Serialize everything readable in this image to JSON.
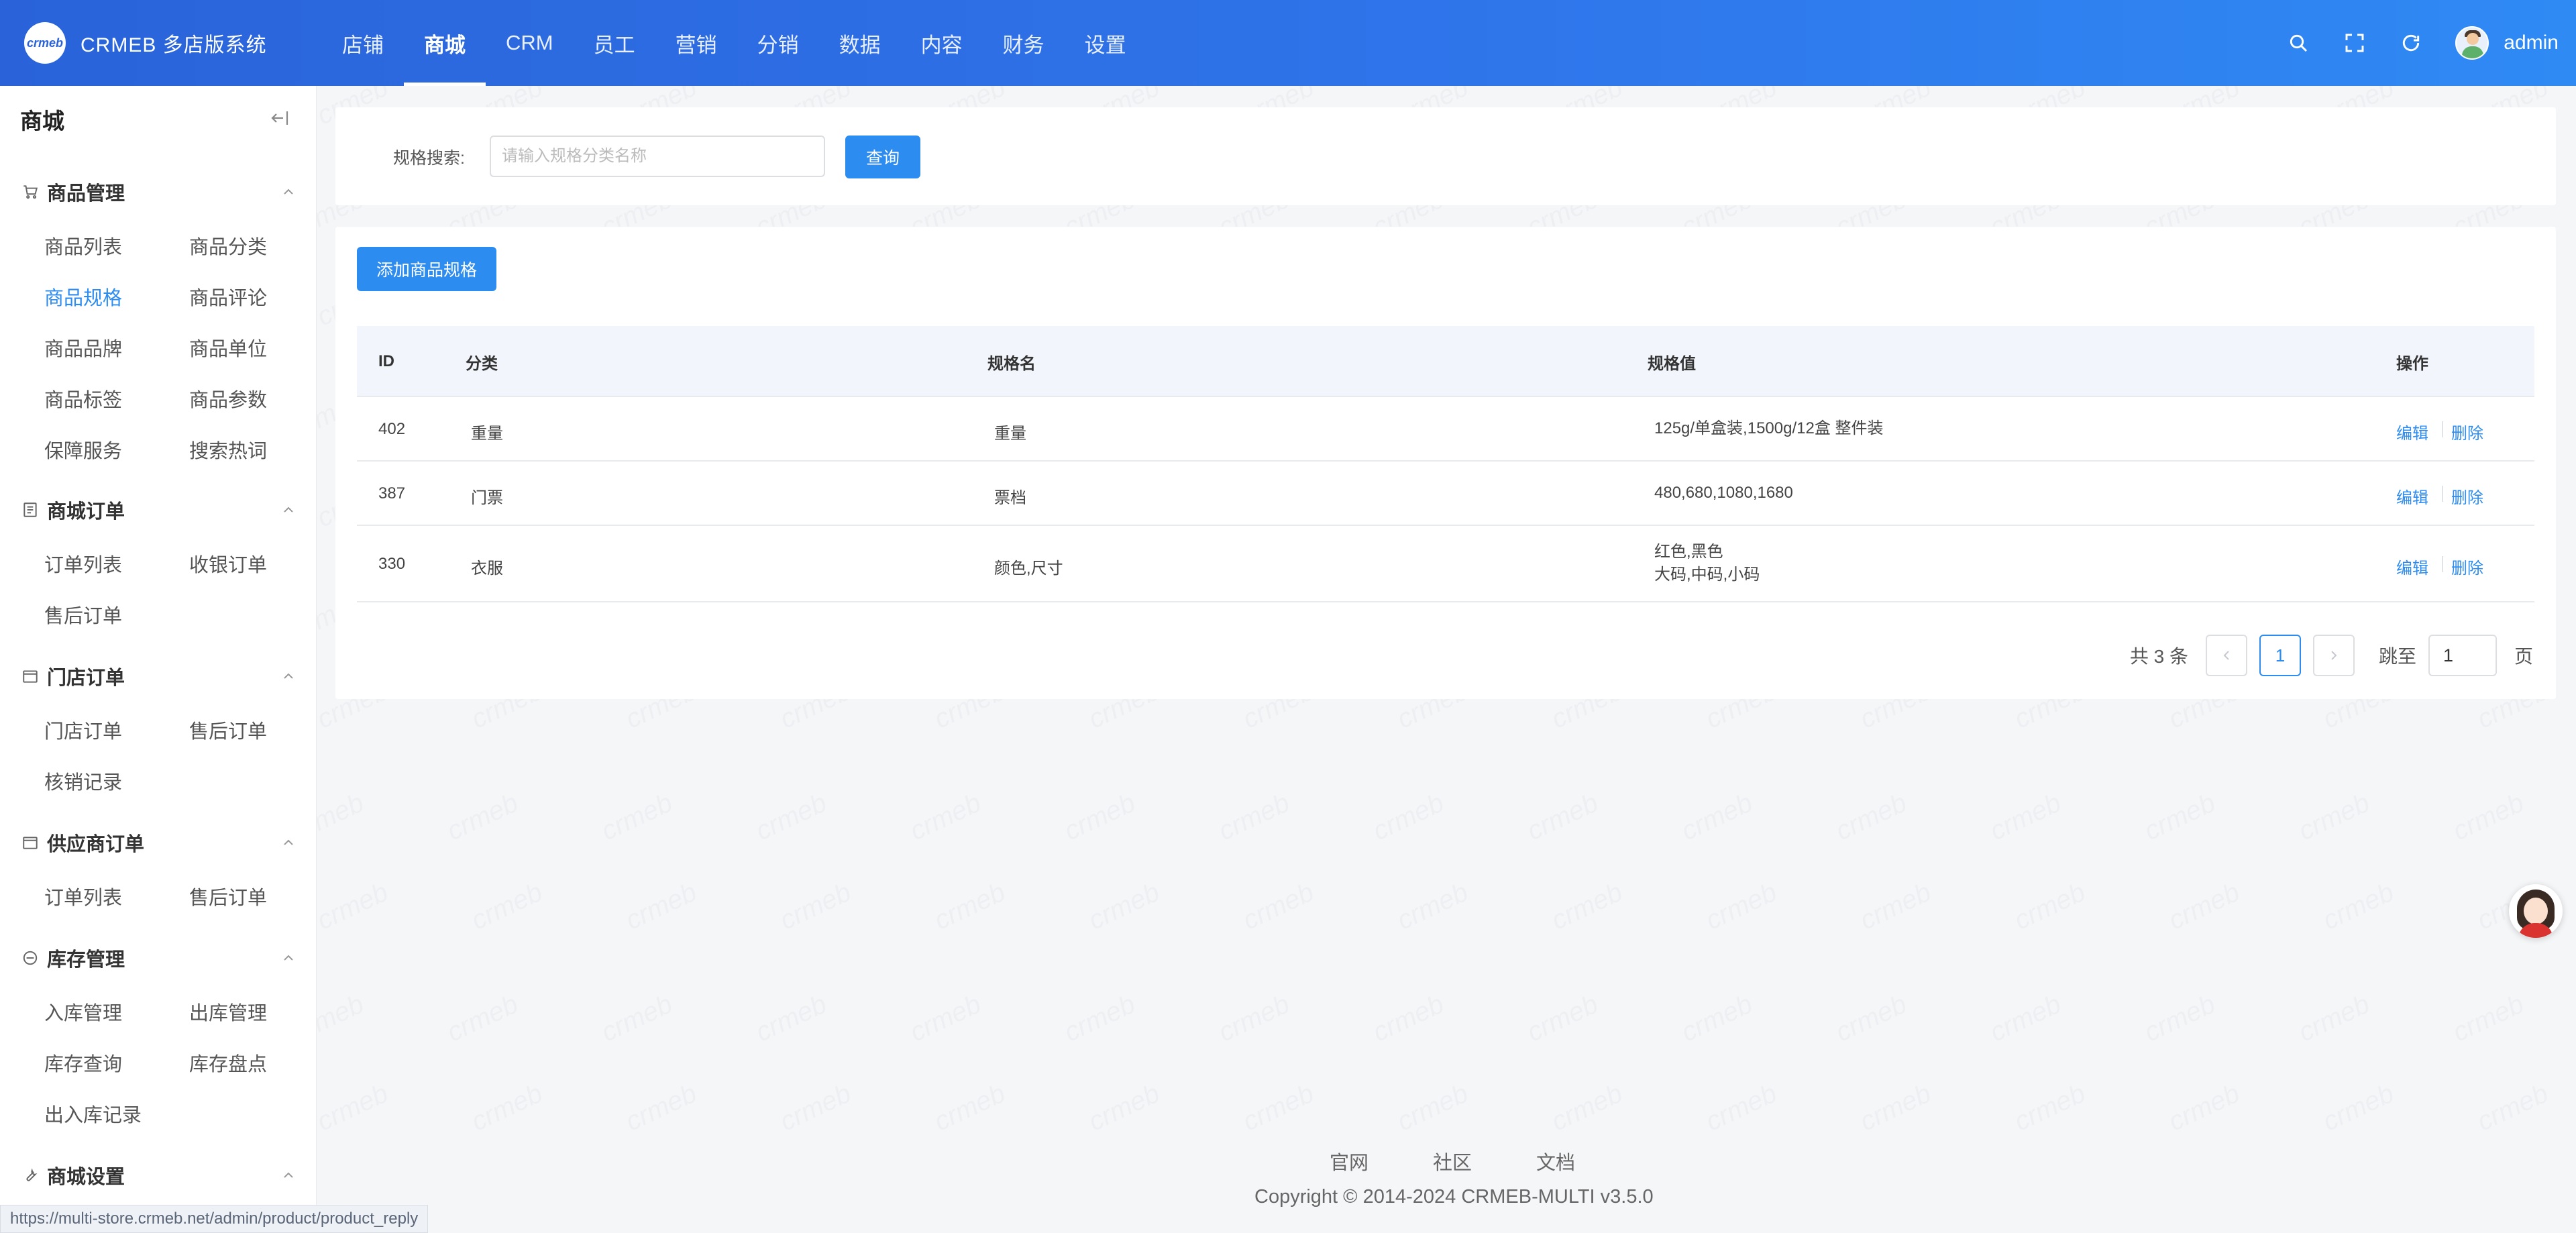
{
  "app": {
    "logo_text": "crmeb",
    "title": "CRMEB 多店版系统",
    "watermark": "crmeb"
  },
  "topnav": {
    "items": [
      {
        "label": "店铺",
        "active": false
      },
      {
        "label": "商城",
        "active": true
      },
      {
        "label": "CRM",
        "active": false
      },
      {
        "label": "员工",
        "active": false
      },
      {
        "label": "营销",
        "active": false
      },
      {
        "label": "分销",
        "active": false
      },
      {
        "label": "数据",
        "active": false
      },
      {
        "label": "内容",
        "active": false
      },
      {
        "label": "财务",
        "active": false
      },
      {
        "label": "设置",
        "active": false
      }
    ],
    "user": "admin"
  },
  "sidebar": {
    "title": "商城",
    "groups": [
      {
        "label": "商品管理",
        "icon": "cart-icon",
        "items": [
          "商品列表",
          "商品分类",
          "商品规格",
          "商品评论",
          "商品品牌",
          "商品单位",
          "商品标签",
          "商品参数",
          "保障服务",
          "搜索热词"
        ],
        "active_item": "商品规格"
      },
      {
        "label": "商城订单",
        "icon": "order-icon",
        "items": [
          "订单列表",
          "收银订单",
          "售后订单"
        ]
      },
      {
        "label": "门店订单",
        "icon": "store-order-icon",
        "items": [
          "门店订单",
          "售后订单",
          "核销记录"
        ]
      },
      {
        "label": "供应商订单",
        "icon": "supplier-order-icon",
        "items": [
          "订单列表",
          "售后订单"
        ]
      },
      {
        "label": "库存管理",
        "icon": "inventory-icon",
        "items": [
          "入库管理",
          "出库管理",
          "库存查询",
          "库存盘点",
          "出入库记录"
        ]
      },
      {
        "label": "商城设置",
        "icon": "wrench-icon",
        "items": []
      }
    ]
  },
  "search": {
    "label": "规格搜索:",
    "placeholder": "请输入规格分类名称",
    "value": "",
    "button": "查询"
  },
  "toolbar": {
    "add_button": "添加商品规格"
  },
  "table": {
    "columns": {
      "id": "ID",
      "category": "分类",
      "name": "规格名",
      "values": "规格值",
      "actions": "操作"
    },
    "rows": [
      {
        "id": "402",
        "category": "重量",
        "name": "重量",
        "values": [
          "125g/单盒装,1500g/12盒 整件装"
        ],
        "edit": "编辑",
        "delete": "删除"
      },
      {
        "id": "387",
        "category": "门票",
        "name": "票档",
        "values": [
          "480,680,1080,1680"
        ],
        "edit": "编辑",
        "delete": "删除"
      },
      {
        "id": "330",
        "category": "衣服",
        "name": "颜色,尺寸",
        "values": [
          "红色,黑色",
          "大码,中码,小码"
        ],
        "edit": "编辑",
        "delete": "删除"
      }
    ]
  },
  "pagination": {
    "total_text": "共 3 条",
    "current_page": "1",
    "jump_label": "跳至",
    "jump_value": "1",
    "page_suffix": "页"
  },
  "footer": {
    "links": [
      "官网",
      "社区",
      "文档"
    ],
    "copyright": "Copyright © 2014-2024 CRMEB-MULTI v3.5.0"
  },
  "status_bar": {
    "url": "https://multi-store.crmeb.net/admin/product/product_reply"
  },
  "colors": {
    "primary": "#2d8cf0",
    "header_start": "#2a63d9",
    "header_end": "#2f8af4",
    "page_bg": "#f5f6f8"
  }
}
